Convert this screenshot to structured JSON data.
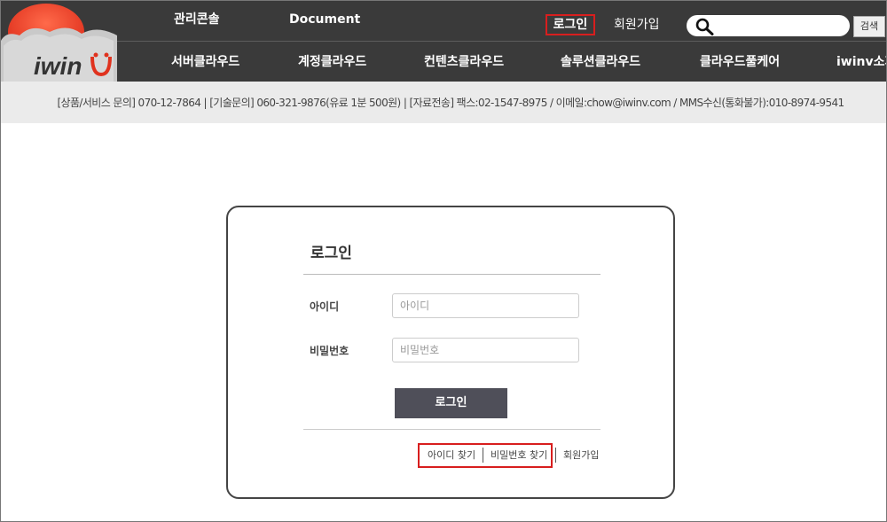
{
  "logo": {
    "text": "iwin"
  },
  "top_nav": {
    "console": "관리콘솔",
    "document": "Document",
    "login": "로그인",
    "signup": "회원가입",
    "search_placeholder": "",
    "search_button": "검색"
  },
  "main_nav": [
    "서버클라우드",
    "계정클라우드",
    "컨텐츠클라우드",
    "솔루션클라우드",
    "클라우드풀케어",
    "iwinv소개"
  ],
  "info_bar": {
    "text": "[상품/서비스 문의] 070-12-7864 | [기술문의] 060-321-9876(유료 1분 500원) | [자료전송] 팩스:02-1547-8975 / 이메일:chow@iwinv.com / MMS수신(통화불가):010-8974-9541"
  },
  "login_form": {
    "title": "로그인",
    "id_label": "아이디",
    "id_placeholder": "아이디",
    "password_label": "비밀번호",
    "password_placeholder": "비밀번호",
    "submit": "로그인",
    "find_id": "아이디 찾기",
    "find_password": "비밀번호 찾기",
    "signup": "회원가입"
  },
  "colors": {
    "header_bg": "#3a3a3a",
    "info_bg": "#ebebeb",
    "highlight": "#d81e1e",
    "button_bg": "#4f4f59",
    "logo_sun": "#e8412c"
  }
}
